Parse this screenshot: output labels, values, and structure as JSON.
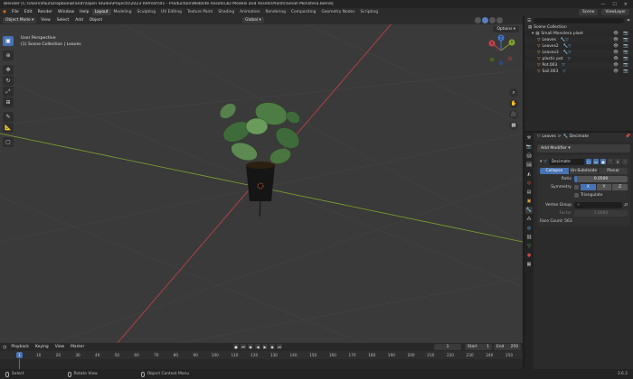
{
  "window": {
    "title": "Blender [C:\\Users\\Paul\\Dropbox\\Brandr\\Open Studio\\Projects\\2023 Refresh\\01 - Production\\Website Assets\\3D Models and Assets\\Plants\\Small Monstera.blend]",
    "min": "—",
    "max": "☐",
    "close": "✕"
  },
  "menubar": {
    "items": [
      "File",
      "Edit",
      "Render",
      "Window",
      "Help"
    ],
    "workspaces": [
      "Layout",
      "Modeling",
      "Sculpting",
      "UV Editing",
      "Texture Paint",
      "Shading",
      "Animation",
      "Rendering",
      "Compositing",
      "Geometry Nodes",
      "Scripting"
    ],
    "active_workspace": "Layout",
    "scene": "Scene",
    "view_layer": "ViewLayer"
  },
  "viewport_header": {
    "mode": "Object Mode",
    "menus": [
      "View",
      "Select",
      "Add",
      "Object"
    ],
    "transform": "Global",
    "options": "Options"
  },
  "viewport": {
    "perspective": "User Perspective",
    "collection": "(1) Scene Collection | Leaves"
  },
  "toolbar": {
    "tools": [
      {
        "name": "select-box-icon",
        "glyph": "▣"
      },
      {
        "name": "cursor-icon",
        "glyph": "⊕"
      },
      {
        "name": "move-icon",
        "glyph": "✥"
      },
      {
        "name": "rotate-icon",
        "glyph": "↻"
      },
      {
        "name": "scale-icon",
        "glyph": "⤢"
      },
      {
        "name": "transform-icon",
        "glyph": "⊞"
      },
      {
        "name": "annotate-icon",
        "glyph": "✎"
      },
      {
        "name": "measure-icon",
        "glyph": "📐"
      },
      {
        "name": "add-cube-icon",
        "glyph": "▢"
      }
    ]
  },
  "gizmo": {
    "x": "X",
    "y": "Y",
    "z": "Z"
  },
  "outliner": {
    "root": "Scene Collection",
    "collection": "Small Monstera plant",
    "objects": [
      "Leaves",
      "Leaves2",
      "Leaves3",
      "plastic pot",
      "Pot.003",
      "Soil.003"
    ],
    "vis": "👁 📷"
  },
  "properties": {
    "object": "Leaves",
    "separator": ">",
    "modifier_title": "Decimate",
    "add_modifier": "Add Modifier",
    "modifier_name": "Decimate",
    "modes": [
      "Collapse",
      "Un-Subdivide",
      "Planar"
    ],
    "active_mode": "Collapse",
    "ratio_label": "Ratio",
    "ratio_value": "0.0500",
    "ratio_fraction": 0.05,
    "symmetry_label": "Symmetry",
    "axes": [
      "X",
      "Y",
      "Z"
    ],
    "triangulate": "Triangulate",
    "vertex_group_label": "Vertex Group",
    "factor_label": "Factor",
    "factor_value": "1.0000",
    "face_count": "Face Count: 563"
  },
  "timeline": {
    "menus": [
      "Playback",
      "Keying",
      "View",
      "Marker"
    ],
    "current_frame": "1",
    "start_label": "Start",
    "start": "1",
    "end_label": "End",
    "end": "250",
    "ticks": [
      "0",
      "10",
      "20",
      "30",
      "40",
      "50",
      "60",
      "70",
      "80",
      "90",
      "100",
      "110",
      "120",
      "130",
      "140",
      "150",
      "160",
      "170",
      "180",
      "190",
      "200",
      "210",
      "220",
      "230",
      "240",
      "250"
    ]
  },
  "statusbar": {
    "select": "Select",
    "rotate": "Rotate View",
    "context": "Object Context Menu",
    "version": "3.6.2"
  },
  "colors": {
    "accent": "#4772b3",
    "axis_x": "#c8424a",
    "axis_y": "#7ea52e",
    "axis_z": "#3f78c9"
  }
}
